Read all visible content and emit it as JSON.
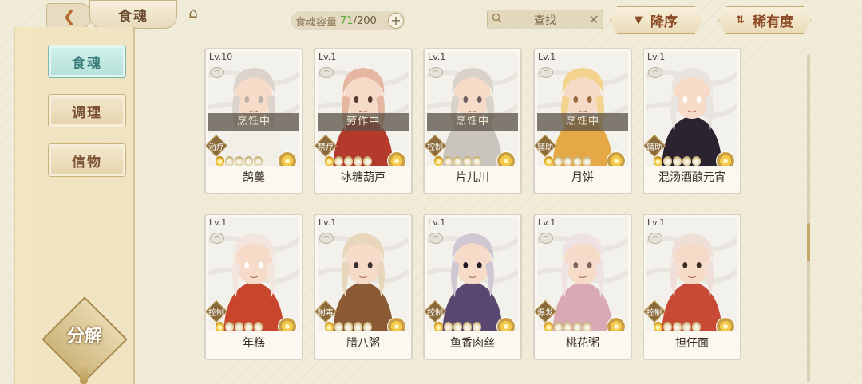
{
  "header": {
    "back_icon": "back-arrow-icon",
    "title": "食魂",
    "home_icon": "home-roof-icon",
    "capacity_label": "食魂容量",
    "capacity_current": "71",
    "capacity_max": "/200",
    "capacity_plus": "+",
    "search_placeholder": "查找",
    "search_clear": "✕",
    "sort_desc_label": "降序",
    "sort_rarity_label": "稀有度",
    "accent": "#5aa83a"
  },
  "sidebar": {
    "items": [
      {
        "label": "食魂",
        "active": true
      },
      {
        "label": "调理",
        "active": false
      },
      {
        "label": "信物",
        "active": false
      }
    ],
    "decompose_label": "分解"
  },
  "cards": [
    {
      "level": "Lv.10",
      "status": "烹饪中",
      "role": "治疗",
      "name": "鹄羹",
      "gold_stars": 1,
      "palette": [
        "#dcd4cc",
        "#f2efe9",
        "#b9b0a8"
      ]
    },
    {
      "level": "Lv.1",
      "status": "劳作中",
      "role": "禁疗",
      "name": "冰糖葫芦",
      "gold_stars": 1,
      "palette": [
        "#e6b7a0",
        "#b43a2c",
        "#5a3a2a"
      ]
    },
    {
      "level": "Lv.1",
      "status": "烹饪中",
      "role": "控制",
      "name": "片儿川",
      "gold_stars": 1,
      "palette": [
        "#d8d2c8",
        "#c9c4bd",
        "#6a6160"
      ]
    },
    {
      "level": "Lv.1",
      "status": "烹饪中",
      "role": "辅助",
      "name": "月饼",
      "gold_stars": 1,
      "palette": [
        "#f3d38d",
        "#e4a845",
        "#9a6a3a"
      ]
    },
    {
      "level": "Lv.1",
      "status": "",
      "role": "辅助",
      "name": "混汤酒酿元宵",
      "gold_stars": 1,
      "palette": [
        "#e9e4e0",
        "#2b2330",
        "#ffffff"
      ]
    },
    {
      "level": "Lv.1",
      "status": "",
      "role": "控制",
      "name": "年糕",
      "gold_stars": 1,
      "palette": [
        "#f2e6df",
        "#c8472c",
        "#ffffff"
      ]
    },
    {
      "level": "Lv.1",
      "status": "",
      "role": "附毒",
      "name": "腊八粥",
      "gold_stars": 1,
      "palette": [
        "#e7d6bc",
        "#8a5a34",
        "#3a3030"
      ]
    },
    {
      "level": "Lv.1",
      "status": "",
      "role": "控制",
      "name": "鱼香肉丝",
      "gold_stars": 1,
      "palette": [
        "#cfc7d2",
        "#5a4770",
        "#1f1a24"
      ]
    },
    {
      "level": "Lv.1",
      "status": "",
      "role": "爆发",
      "name": "桃花粥",
      "gold_stars": 1,
      "palette": [
        "#efe2e4",
        "#d9a9b4",
        "#7b6662"
      ]
    },
    {
      "level": "Lv.1",
      "status": "",
      "role": "控制",
      "name": "担仔面",
      "gold_stars": 1,
      "palette": [
        "#f0dfd6",
        "#c84a34",
        "#3a2a26"
      ]
    }
  ]
}
